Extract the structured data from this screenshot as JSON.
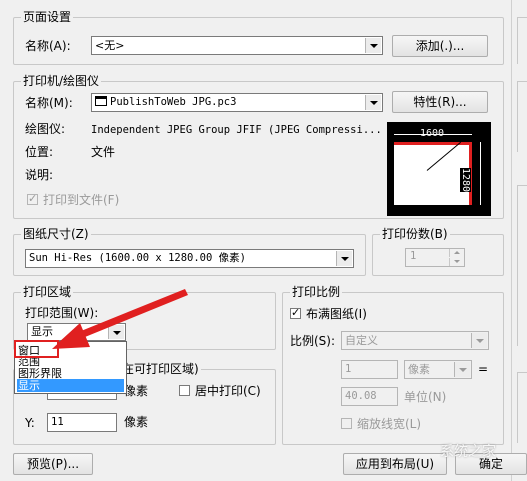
{
  "page_setup": {
    "title": "页面设置",
    "name_label": "名称(A):",
    "name_value": "<无>",
    "add_button": "添加(.)..."
  },
  "printer": {
    "title": "打印机/绘图仪",
    "name_label": "名称(M):",
    "name_value": "PublishToWeb JPG.pc3",
    "properties_button": "特性(R)...",
    "plotter_label": "绘图仪:",
    "plotter_value": "Independent JPEG Group JFIF (JPEG Compressi...",
    "location_label": "位置:",
    "location_value": "文件",
    "description_label": "说明:",
    "print_to_file_label": "打印到文件(F)",
    "print_to_file_checked": true,
    "preview_width": "1600",
    "preview_height": "1280"
  },
  "paper_size": {
    "title": "图纸尺寸(Z)",
    "value": "Sun Hi-Res (1600.00 x 1280.00 像素)"
  },
  "copies": {
    "title": "打印份数(B)",
    "value": "1"
  },
  "plot_area": {
    "title": "打印区域",
    "what_label": "打印范围(W):",
    "what_value": "显示",
    "options": [
      "窗口",
      "范围",
      "图形界限",
      "显示"
    ],
    "selected_option": "显示",
    "highlighted_option": "窗口"
  },
  "plot_offset": {
    "title_suffix": "在可打印区域)",
    "x_unit": "像素",
    "y_label": "Y:",
    "y_value": "11",
    "y_unit": "像素",
    "center_label": "居中打印(C)"
  },
  "plot_scale": {
    "title": "打印比例",
    "fit_label": "布满图纸(I)",
    "fit_checked": true,
    "scale_label": "比例(S):",
    "scale_value": "自定义",
    "numerator": "1",
    "unit_value": "像素",
    "equals": "=",
    "denominator": "40.08",
    "denominator_unit": "单位(N)",
    "lineweights_label": "缩放线宽(L)"
  },
  "footer": {
    "preview_button": "预览(P)...",
    "apply_button": "应用到布局(U)",
    "ok_button": "确定"
  },
  "watermark": "系统之家",
  "colors": {
    "dialog_bg": "#f0f0f0",
    "selection": "#3399ff",
    "annotation_red": "#e02020"
  }
}
